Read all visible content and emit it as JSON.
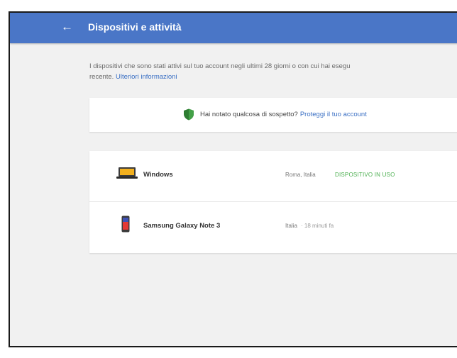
{
  "header": {
    "title": "Dispositivi e attività",
    "back_icon": "←"
  },
  "description": {
    "text": "I dispositivi che sono stati attivi sul tuo account negli ultimi 28 giorni o con cui hai esegu",
    "text2": "recente.",
    "link": "Ulteriori informazioni"
  },
  "suspicious": {
    "icon": "shield-icon",
    "question": "Hai notato qualcosa di sospetto?",
    "link": "Proteggi il tuo account"
  },
  "devices": [
    {
      "name": "Windows",
      "icon": "laptop-icon",
      "location": "Roma, Italia",
      "status": "DISPOSITIVO IN USO"
    },
    {
      "name": "Samsung Galaxy Note 3",
      "icon": "phone-icon",
      "location": "Italia",
      "time": " · 18 minuti fa"
    }
  ],
  "colors": {
    "header_bg": "#4a76c7",
    "link": "#3b70c4",
    "status_green": "#4caf50",
    "page_bg": "#f1f1f1"
  }
}
